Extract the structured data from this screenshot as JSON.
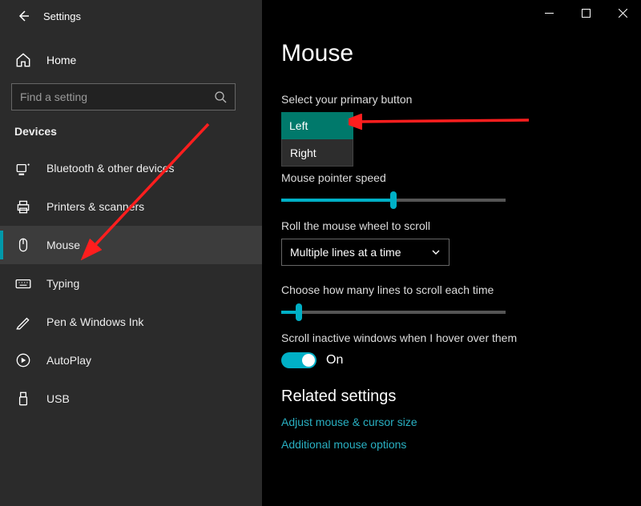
{
  "titlebar": {
    "title": "Settings"
  },
  "sidebar": {
    "home": "Home",
    "search_placeholder": "Find a setting",
    "section_label": "Devices",
    "items": [
      {
        "label": "Bluetooth & other devices"
      },
      {
        "label": "Printers & scanners"
      },
      {
        "label": "Mouse"
      },
      {
        "label": "Typing"
      },
      {
        "label": "Pen & Windows Ink"
      },
      {
        "label": "AutoPlay"
      },
      {
        "label": "USB"
      }
    ]
  },
  "main": {
    "page_title": "Mouse",
    "primary_btn_label": "Select your primary button",
    "primary_btn_options": {
      "selected": "Left",
      "other": "Right"
    },
    "pointer_speed_label": "Mouse pointer speed",
    "pointer_speed_percent": 50,
    "wheel_label": "Roll the mouse wheel to scroll",
    "wheel_value": "Multiple lines at a time",
    "lines_label": "Choose how many lines to scroll each time",
    "lines_percent": 8,
    "hover_label": "Scroll inactive windows when I hover over them",
    "hover_toggle": "On",
    "related_head": "Related settings",
    "link_adjust": "Adjust mouse & cursor size",
    "link_additional": "Additional mouse options"
  }
}
